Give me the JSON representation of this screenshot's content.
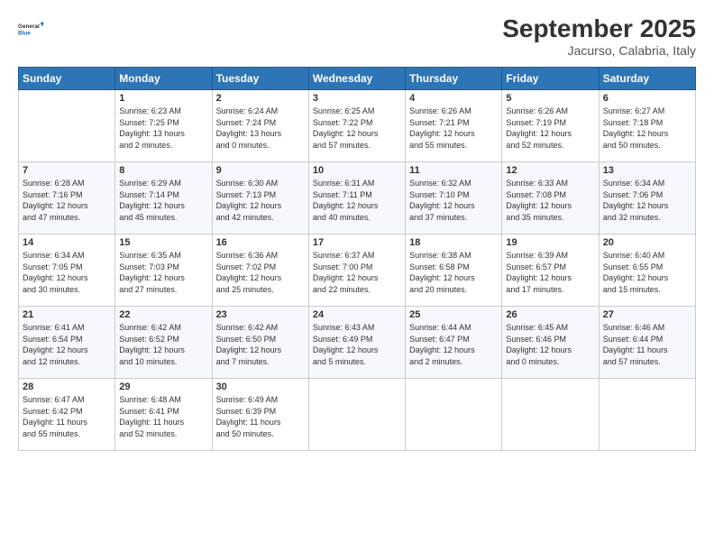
{
  "logo": {
    "text_general": "General",
    "text_blue": "Blue"
  },
  "header": {
    "month": "September 2025",
    "location": "Jacurso, Calabria, Italy"
  },
  "weekdays": [
    "Sunday",
    "Monday",
    "Tuesday",
    "Wednesday",
    "Thursday",
    "Friday",
    "Saturday"
  ],
  "weeks": [
    [
      {
        "day": "",
        "info": ""
      },
      {
        "day": "1",
        "info": "Sunrise: 6:23 AM\nSunset: 7:25 PM\nDaylight: 13 hours\nand 2 minutes."
      },
      {
        "day": "2",
        "info": "Sunrise: 6:24 AM\nSunset: 7:24 PM\nDaylight: 13 hours\nand 0 minutes."
      },
      {
        "day": "3",
        "info": "Sunrise: 6:25 AM\nSunset: 7:22 PM\nDaylight: 12 hours\nand 57 minutes."
      },
      {
        "day": "4",
        "info": "Sunrise: 6:26 AM\nSunset: 7:21 PM\nDaylight: 12 hours\nand 55 minutes."
      },
      {
        "day": "5",
        "info": "Sunrise: 6:26 AM\nSunset: 7:19 PM\nDaylight: 12 hours\nand 52 minutes."
      },
      {
        "day": "6",
        "info": "Sunrise: 6:27 AM\nSunset: 7:18 PM\nDaylight: 12 hours\nand 50 minutes."
      }
    ],
    [
      {
        "day": "7",
        "info": "Sunrise: 6:28 AM\nSunset: 7:16 PM\nDaylight: 12 hours\nand 47 minutes."
      },
      {
        "day": "8",
        "info": "Sunrise: 6:29 AM\nSunset: 7:14 PM\nDaylight: 12 hours\nand 45 minutes."
      },
      {
        "day": "9",
        "info": "Sunrise: 6:30 AM\nSunset: 7:13 PM\nDaylight: 12 hours\nand 42 minutes."
      },
      {
        "day": "10",
        "info": "Sunrise: 6:31 AM\nSunset: 7:11 PM\nDaylight: 12 hours\nand 40 minutes."
      },
      {
        "day": "11",
        "info": "Sunrise: 6:32 AM\nSunset: 7:10 PM\nDaylight: 12 hours\nand 37 minutes."
      },
      {
        "day": "12",
        "info": "Sunrise: 6:33 AM\nSunset: 7:08 PM\nDaylight: 12 hours\nand 35 minutes."
      },
      {
        "day": "13",
        "info": "Sunrise: 6:34 AM\nSunset: 7:06 PM\nDaylight: 12 hours\nand 32 minutes."
      }
    ],
    [
      {
        "day": "14",
        "info": "Sunrise: 6:34 AM\nSunset: 7:05 PM\nDaylight: 12 hours\nand 30 minutes."
      },
      {
        "day": "15",
        "info": "Sunrise: 6:35 AM\nSunset: 7:03 PM\nDaylight: 12 hours\nand 27 minutes."
      },
      {
        "day": "16",
        "info": "Sunrise: 6:36 AM\nSunset: 7:02 PM\nDaylight: 12 hours\nand 25 minutes."
      },
      {
        "day": "17",
        "info": "Sunrise: 6:37 AM\nSunset: 7:00 PM\nDaylight: 12 hours\nand 22 minutes."
      },
      {
        "day": "18",
        "info": "Sunrise: 6:38 AM\nSunset: 6:58 PM\nDaylight: 12 hours\nand 20 minutes."
      },
      {
        "day": "19",
        "info": "Sunrise: 6:39 AM\nSunset: 6:57 PM\nDaylight: 12 hours\nand 17 minutes."
      },
      {
        "day": "20",
        "info": "Sunrise: 6:40 AM\nSunset: 6:55 PM\nDaylight: 12 hours\nand 15 minutes."
      }
    ],
    [
      {
        "day": "21",
        "info": "Sunrise: 6:41 AM\nSunset: 6:54 PM\nDaylight: 12 hours\nand 12 minutes."
      },
      {
        "day": "22",
        "info": "Sunrise: 6:42 AM\nSunset: 6:52 PM\nDaylight: 12 hours\nand 10 minutes."
      },
      {
        "day": "23",
        "info": "Sunrise: 6:42 AM\nSunset: 6:50 PM\nDaylight: 12 hours\nand 7 minutes."
      },
      {
        "day": "24",
        "info": "Sunrise: 6:43 AM\nSunset: 6:49 PM\nDaylight: 12 hours\nand 5 minutes."
      },
      {
        "day": "25",
        "info": "Sunrise: 6:44 AM\nSunset: 6:47 PM\nDaylight: 12 hours\nand 2 minutes."
      },
      {
        "day": "26",
        "info": "Sunrise: 6:45 AM\nSunset: 6:46 PM\nDaylight: 12 hours\nand 0 minutes."
      },
      {
        "day": "27",
        "info": "Sunrise: 6:46 AM\nSunset: 6:44 PM\nDaylight: 11 hours\nand 57 minutes."
      }
    ],
    [
      {
        "day": "28",
        "info": "Sunrise: 6:47 AM\nSunset: 6:42 PM\nDaylight: 11 hours\nand 55 minutes."
      },
      {
        "day": "29",
        "info": "Sunrise: 6:48 AM\nSunset: 6:41 PM\nDaylight: 11 hours\nand 52 minutes."
      },
      {
        "day": "30",
        "info": "Sunrise: 6:49 AM\nSunset: 6:39 PM\nDaylight: 11 hours\nand 50 minutes."
      },
      {
        "day": "",
        "info": ""
      },
      {
        "day": "",
        "info": ""
      },
      {
        "day": "",
        "info": ""
      },
      {
        "day": "",
        "info": ""
      }
    ]
  ]
}
